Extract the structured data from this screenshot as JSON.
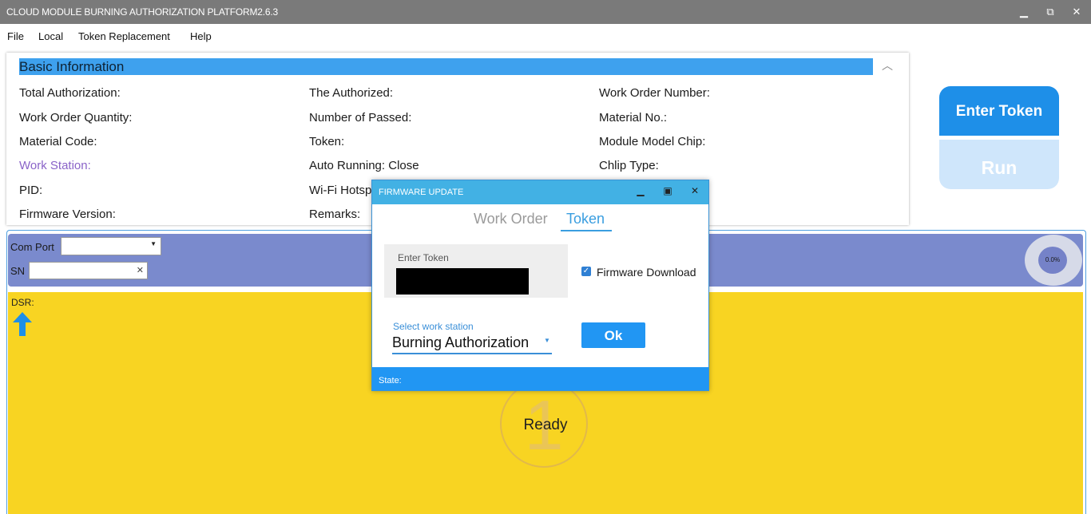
{
  "window": {
    "title": "CLOUD MODULE BURNING AUTHORIZATION PLATFORM2.6.3",
    "minimize": "▁",
    "restore": "⧉",
    "close": "✕"
  },
  "menu": [
    "File",
    "Local",
    "Token Replacement",
    "Help"
  ],
  "basic_info": {
    "header": "Basic Information",
    "collapse_glyph": "︿",
    "columns": [
      [
        "Total Authorization:",
        "Work Order Quantity:",
        "Material Code:",
        "Work Station:",
        "PID:",
        "Firmware Version:"
      ],
      [
        "The Authorized:",
        "Number of Passed:",
        "Token:",
        "Auto Running: Close",
        "Wi-Fi Hotspot:",
        "Remarks:"
      ],
      [
        "Work Order Number:",
        "Material No.:",
        "Module Model Chip:",
        "Chlip Type:"
      ]
    ]
  },
  "actions": {
    "enter_token": "Enter Token",
    "run": "Run"
  },
  "station": {
    "com_port_label": "Com Port",
    "com_port_value": "",
    "sn_label": "SN",
    "sn_value": "",
    "progress": "0.0%",
    "dsr_label": "DSR:",
    "station_number": "1",
    "ready_text": "Ready"
  },
  "dialog": {
    "title": "FIRMWARE UPDATE",
    "tabs": [
      "Work Order",
      "Token"
    ],
    "active_tab": "Token",
    "token_label": "Enter Token",
    "firmware_download_label": "Firmware Download",
    "firmware_download_checked": true,
    "work_station_label": "Select work station",
    "work_station_value": "Burning Authorization",
    "ok_label": "Ok",
    "state_label": "State:"
  },
  "colors": {
    "titlebar": "#7a7a7a",
    "accent": "#2196f3",
    "header_blue": "#3ea1ee",
    "purple_band": "#7a8acd",
    "yellow": "#f8d422"
  }
}
